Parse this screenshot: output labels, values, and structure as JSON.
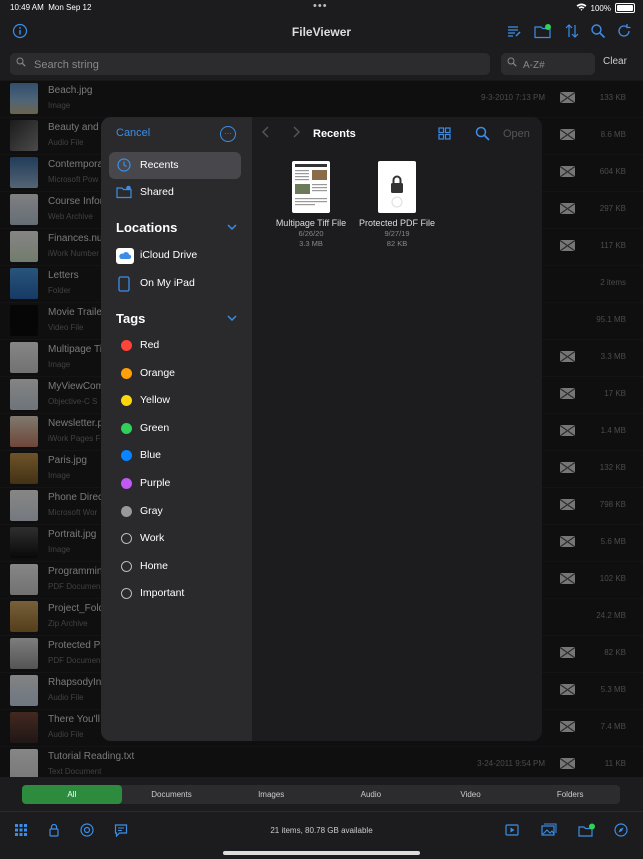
{
  "status_bar": {
    "time": "10:49 AM",
    "date": "Mon Sep 12",
    "battery": "100%"
  },
  "app": {
    "title": "FileViewer"
  },
  "search": {
    "placeholder": "Search string",
    "filter_placeholder": "A-Z#",
    "clear_label": "Clear"
  },
  "files": [
    {
      "name": "Beach.jpg",
      "type": "Image",
      "date": "9-3-2010 7:13 PM",
      "size": "133 KB",
      "mail": true,
      "thumb": "photo-blue"
    },
    {
      "name": "Beauty and t",
      "type": "Audio File",
      "date": "",
      "size": "8.6 MB",
      "mail": true,
      "thumb": "album"
    },
    {
      "name": "Contempora",
      "type": "Microsoft Pow",
      "date": "",
      "size": "604 KB",
      "mail": true,
      "thumb": "slides"
    },
    {
      "name": "Course Infor",
      "type": "Web Archive",
      "date": "",
      "size": "297 KB",
      "mail": true,
      "thumb": "web"
    },
    {
      "name": "Finances.nu",
      "type": "iWork Number",
      "date": "",
      "size": "117 KB",
      "mail": true,
      "thumb": "sheet"
    },
    {
      "name": "Letters",
      "type": "Folder",
      "date": "",
      "size": "2 items",
      "mail": false,
      "thumb": "folder"
    },
    {
      "name": "Movie Traile",
      "type": "Video File",
      "date": "",
      "size": "95.1 MB",
      "mail": false,
      "thumb": "video"
    },
    {
      "name": "Multipage Ti",
      "type": "Image",
      "date": "",
      "size": "3.3 MB",
      "mail": true,
      "thumb": "doc"
    },
    {
      "name": "MyViewCom",
      "type": "Objective-C S",
      "date": "",
      "size": "17 KB",
      "mail": true,
      "thumb": "code"
    },
    {
      "name": "Newsletter.p",
      "type": "iWork Pages F",
      "date": "",
      "size": "1.4 MB",
      "mail": true,
      "thumb": "pages"
    },
    {
      "name": "Paris.jpg",
      "type": "Image",
      "date": "",
      "size": "132 KB",
      "mail": true,
      "thumb": "photo-gold"
    },
    {
      "name": "Phone Direc",
      "type": "Microsoft Wor",
      "date": "",
      "size": "798 KB",
      "mail": true,
      "thumb": "word"
    },
    {
      "name": "Portrait.jpg",
      "type": "Image",
      "date": "",
      "size": "5.6 MB",
      "mail": true,
      "thumb": "portrait"
    },
    {
      "name": "Programmin",
      "type": "PDF Documen",
      "date": "",
      "size": "102 KB",
      "mail": true,
      "thumb": "doc"
    },
    {
      "name": "Project_Fold",
      "type": "Zip Archive",
      "date": "",
      "size": "24.2 MB",
      "mail": false,
      "thumb": "zip"
    },
    {
      "name": "Protected Pl",
      "type": "PDF Documen",
      "date": "",
      "size": "82 KB",
      "mail": true,
      "thumb": "pdf"
    },
    {
      "name": "RhapsodyIn",
      "type": "Audio File",
      "date": "",
      "size": "5.3 MB",
      "mail": true,
      "thumb": "music"
    },
    {
      "name": "There You'll",
      "type": "Audio File",
      "date": "",
      "size": "7.4 MB",
      "mail": true,
      "thumb": "album2"
    },
    {
      "name": "Tutorial Reading.txt",
      "type": "Text Document",
      "date": "3-24-2011 9:54 PM",
      "size": "11 KB",
      "mail": true,
      "thumb": "text"
    }
  ],
  "segments": [
    "All",
    "Documents",
    "Images",
    "Audio",
    "Video",
    "Folders"
  ],
  "selected_segment": "All",
  "toolbar": {
    "status": "21 items, 80.78 GB available"
  },
  "picker": {
    "cancel_label": "Cancel",
    "open_label": "Open",
    "current_title": "Recents",
    "favorites": [
      {
        "label": "Recents",
        "icon": "clock-icon",
        "selected": true
      },
      {
        "label": "Shared",
        "icon": "shared-folder-icon",
        "selected": false
      }
    ],
    "locations_header": "Locations",
    "locations": [
      {
        "label": "iCloud Drive",
        "icon": "icloud-icon"
      },
      {
        "label": "On My iPad",
        "icon": "ipad-icon"
      }
    ],
    "tags_header": "Tags",
    "tags": [
      {
        "label": "Red",
        "color": "#ff453a"
      },
      {
        "label": "Orange",
        "color": "#ff9f0a"
      },
      {
        "label": "Yellow",
        "color": "#ffd60a"
      },
      {
        "label": "Green",
        "color": "#30d158"
      },
      {
        "label": "Blue",
        "color": "#0a84ff"
      },
      {
        "label": "Purple",
        "color": "#bf5af2"
      },
      {
        "label": "Gray",
        "color": "#98989d"
      },
      {
        "label": "Work",
        "color": ""
      },
      {
        "label": "Home",
        "color": ""
      },
      {
        "label": "Important",
        "color": ""
      }
    ],
    "documents": [
      {
        "name": "Multipage Tiff File",
        "date": "6/26/20",
        "size": "3.3 MB",
        "thumb": "doc"
      },
      {
        "name": "Protected PDF File",
        "date": "9/27/19",
        "size": "82 KB",
        "thumb": "lock"
      }
    ]
  },
  "colors": {
    "accent": "#3b8ee8",
    "segment_selected": "#2c8b3c",
    "background": "#1c1c1e",
    "sidebar": "#2a2a2d"
  }
}
